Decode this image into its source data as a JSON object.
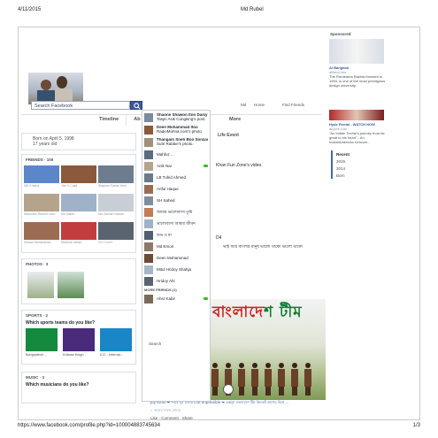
{
  "print": {
    "date": "4/11/2015",
    "title": "Md Rubel",
    "url": "https://www.facebook.com/profile.php?id=100004883745634",
    "page": "1/3"
  },
  "header": {
    "search_placeholder": "Search Facebook",
    "links": [
      "Md",
      "Home",
      "Find Friends"
    ]
  },
  "tabs": [
    "Timeline",
    "Ab",
    "s"
  ],
  "tab_more": "More",
  "intro": {
    "born": "Born on April 5, 1998",
    "age": "17 years old"
  },
  "friends": {
    "header": "FRIENDS · 100",
    "items": [
      {
        "name": "MD Khairul",
        "color": "#5b86c9"
      },
      {
        "name": "Jhe G Caldi",
        "color": "#8a5a3c"
      },
      {
        "name": "Stephen Farias Kent",
        "color": "#6d7d8f"
      },
      {
        "name": "Mamunur Rashid Leon",
        "color": "#b5a48c"
      },
      {
        "name": "Md Habib",
        "color": "#9fb2c8"
      },
      {
        "name": "Md Zamiul Hossan",
        "color": "#c9ced6"
      },
      {
        "name": "Dewan Mohammed",
        "color": "#9c6c52"
      },
      {
        "name": "Mahbub Jahan",
        "color": "#c23d3d"
      },
      {
        "name": "নীল আকাশ",
        "color": "#5a6470"
      }
    ]
  },
  "photos": {
    "header": "PHOTOS · 3"
  },
  "sports": {
    "header": "SPORTS · 2",
    "question": "Which sports teams do you like?",
    "teams": [
      {
        "name": "Bangladesh ...",
        "color": "#138a3e"
      },
      {
        "name": "Kolkata Knigh...",
        "color": "#4a2a7a"
      },
      {
        "name": "ICC - Internat...",
        "color": "#1b86c7"
      }
    ]
  },
  "music": {
    "header": "MUSIC · 3",
    "question": "Which musicians do you like?"
  },
  "feed": {
    "life_event": "Life Event",
    "line1": "Khan Fun Zone's video.",
    "line2": "ভাই আর বাংলার মানুষ ভালো থাকো ভালো থাকো",
    "line3": "D4",
    "banner_red": "বাংলাদে",
    "banner_green": "শ টীম",
    "caption": "Joy Khan ➡ সবাই খুব মজার Life Impossible ➡ এক্সট্রা বাংলাদেশ টিম ক্রিকেট কাপের বিশ্বে ...",
    "caption2": "১ জনের সাথে শেয়ার",
    "actions": "Like · Comment · Share",
    "search": "Search"
  },
  "chat": {
    "items": [
      {
        "name": "Shaone Shawon Iton Daisy",
        "sub": "Tasjin Asik Cungking's post.",
        "color": "#7a8b9c",
        "online": false
      },
      {
        "name": "Deen Mohammad Itoo",
        "sub": "RadioMohna.com's photo.",
        "color": "#8a5a3c",
        "online": false
      },
      {
        "name": "Thangam Sneh Boo Sonzai",
        "sub": "Sufe Rabbie's photo.",
        "color": "#a3907a",
        "online": false
      },
      {
        "name": "Mahfuz ...",
        "sub": "",
        "color": "#5c6b7d",
        "online": false
      },
      {
        "name": "Anik Nai",
        "sub": "",
        "color": "#b5a48c",
        "online": true
      },
      {
        "name": "LB Tuhid Ahmed",
        "sub": "",
        "color": "#6b7a8a",
        "online": false
      },
      {
        "name": "Ariful Haque",
        "sub": "",
        "color": "#9c6c52",
        "online": false
      },
      {
        "name": "SH Sahed",
        "sub": "",
        "color": "#7d8ea1",
        "online": false
      },
      {
        "name": "আমার ভালোবাসা তুমি",
        "sub": "",
        "color": "#c27b5b",
        "online": false
      },
      {
        "name": "ভালোবাসা আমার জীবন",
        "sub": "",
        "color": "#9fb2c8",
        "online": false
      },
      {
        "name": "শুভ ও মা",
        "sub": "",
        "color": "#4f5e70",
        "online": false
      },
      {
        "name": "Md Emon",
        "sub": "",
        "color": "#8d7a66",
        "online": false
      },
      {
        "name": "Deen Mohammad",
        "sub": "",
        "color": "#6b4a36",
        "online": false
      },
      {
        "name": "Mitul Hridoy Shahja",
        "sub": "",
        "color": "#a8b6c6",
        "online": false
      },
      {
        "name": "Hridoy Ahi",
        "sub": "",
        "color": "#5a6470",
        "online": false
      }
    ],
    "more_header": "MORE FRIENDS (1)",
    "more_items": [
      {
        "name": "Ahsr Kabir",
        "sub": "",
        "color": "#7a6a5a",
        "online": true
      }
    ]
  },
  "right": {
    "sponsored": "Sponsored",
    "ad1_title": "AI Bangbok",
    "ad1_source": "aifiabd.info",
    "ad1_text": "The Rizvieama Rakhia founded in 1994, is one of the most prestigious design university.",
    "ad2_title": "Hyde Rental - WATCH NOW",
    "ad2_source": "akqchi.com",
    "ad2_text": "\"An Indian Techie's journey from far great to his heart\" - An IndianAmerican romcom...",
    "years": [
      "Recent",
      "2015",
      "2014",
      "Born"
    ]
  }
}
